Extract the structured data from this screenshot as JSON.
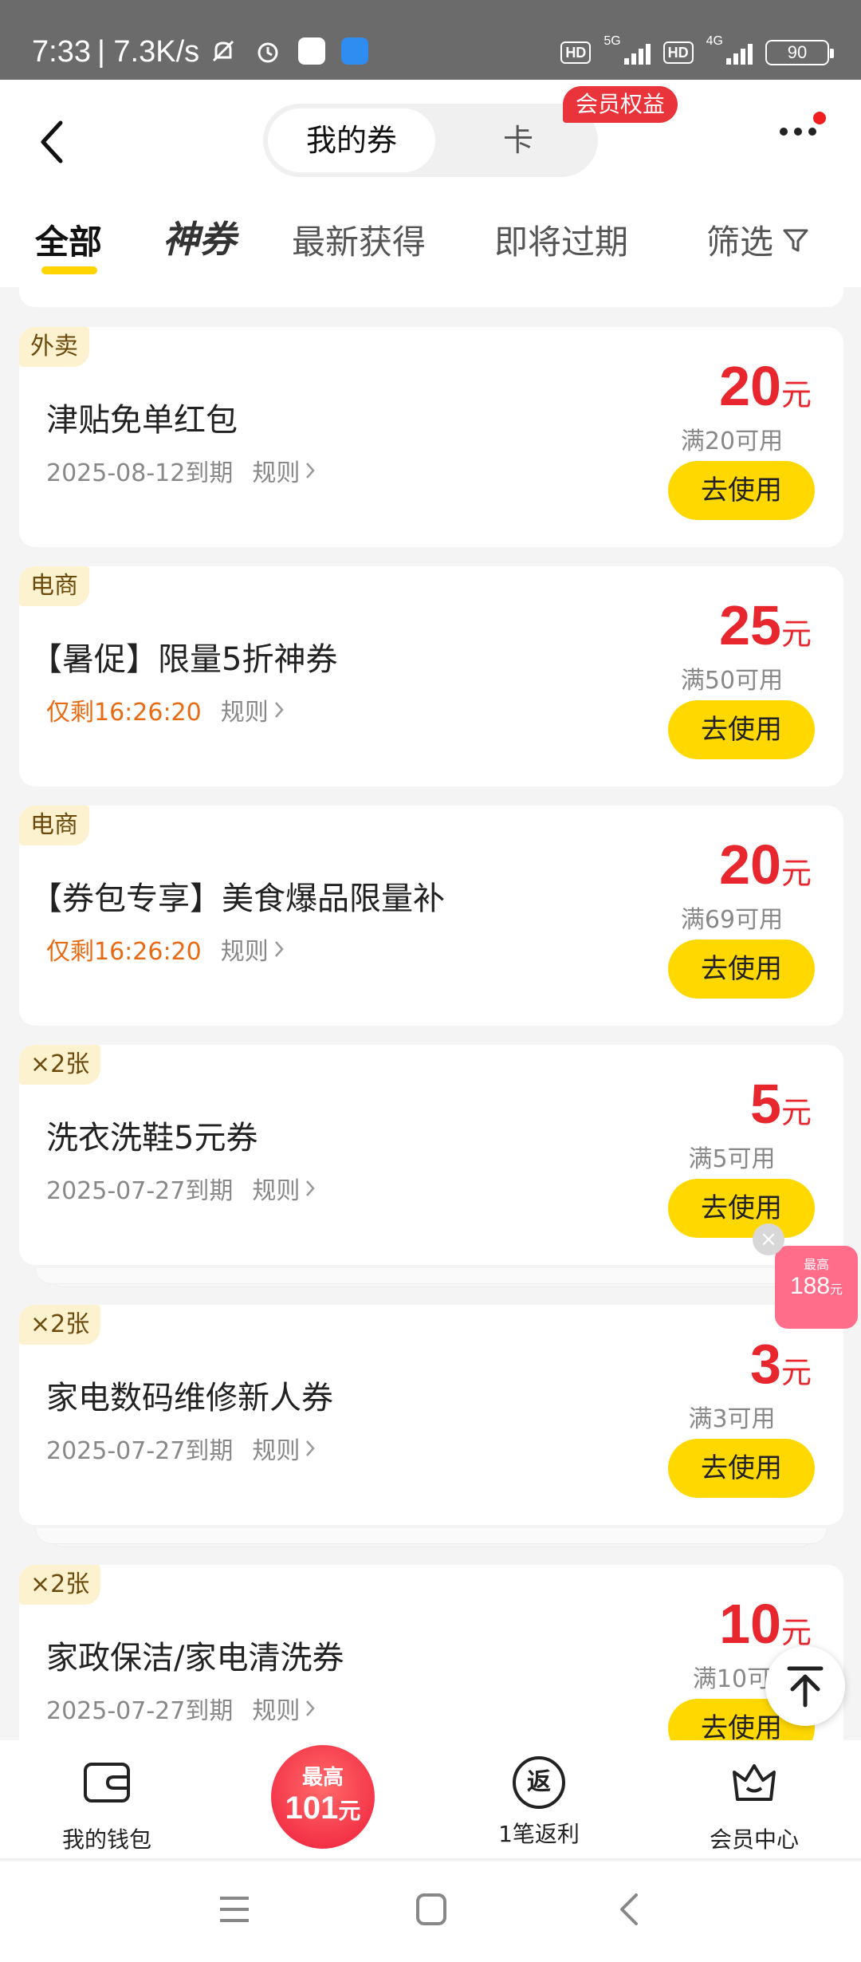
{
  "status_bar": {
    "time": "7:33",
    "speed": "| 7.3K/s",
    "hd1": "HD",
    "net1": "5G",
    "hd2": "HD",
    "net2": "4G",
    "battery": "90"
  },
  "header": {
    "seg_coupons": "我的券",
    "seg_cards": "卡",
    "member_badge": "会员权益"
  },
  "tabs": {
    "all": "全部",
    "shen": "神券",
    "newest": "最新获得",
    "expiring": "即将过期",
    "filter": "筛选"
  },
  "coupons": [
    {
      "tag": "外卖",
      "title": "津贴免单红包",
      "expiry": "2025-08-12到期",
      "countdown": "",
      "rules": "规则",
      "amount": "20",
      "unit": "元",
      "condition": "满20可用",
      "button": "去使用"
    },
    {
      "tag": "电商",
      "title": "【暑促】限量5折神券",
      "expiry": "",
      "countdown": "仅剩16:26:20",
      "rules": "规则",
      "amount": "25",
      "unit": "元",
      "condition": "满50可用",
      "button": "去使用"
    },
    {
      "tag": "电商",
      "title": "【券包专享】美食爆品限量补",
      "expiry": "",
      "countdown": "仅剩16:26:20",
      "rules": "规则",
      "amount": "20",
      "unit": "元",
      "condition": "满69可用",
      "button": "去使用"
    },
    {
      "tag": "×2张",
      "title": "洗衣洗鞋5元券",
      "expiry": "2025-07-27到期",
      "countdown": "",
      "rules": "规则",
      "amount": "5",
      "unit": "元",
      "condition": "满5可用",
      "button": "去使用"
    },
    {
      "tag": "×2张",
      "title": "家电数码维修新人券",
      "expiry": "2025-07-27到期",
      "countdown": "",
      "rules": "规则",
      "amount": "3",
      "unit": "元",
      "condition": "满3可用",
      "button": "去使用"
    },
    {
      "tag": "×2张",
      "title": "家政保洁/家电清洗券",
      "expiry": "2025-07-27到期",
      "countdown": "",
      "rules": "规则",
      "amount": "10",
      "unit": "元",
      "condition": "满10可",
      "button": "去使用"
    }
  ],
  "float_promo": {
    "small": "最高",
    "value": "188",
    "unit": "元"
  },
  "bottom_bar": {
    "wallet": "我的钱包",
    "promo_small": "最高",
    "promo_value": "101",
    "promo_unit": "元",
    "rebate_icon": "返",
    "rebate": "1笔返利",
    "member": "会员中心"
  },
  "colors": {
    "accent_yellow": "#ffd800",
    "price_red": "#e8262e",
    "countdown_orange": "#e86a12",
    "tag_bg": "#fdf2cf"
  }
}
